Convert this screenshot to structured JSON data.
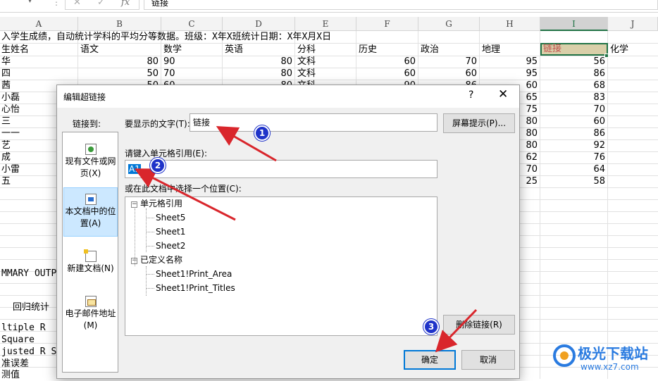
{
  "formula_bar": {
    "namebox_arrow": "▾",
    "dots": "⋮",
    "cancel": "✕",
    "enter": "✓",
    "fx": "fx",
    "content": "链接"
  },
  "columns": [
    "A",
    "B",
    "C",
    "D",
    "E",
    "F",
    "G",
    "H",
    "I",
    "J"
  ],
  "sheet": {
    "title_row": "入学生成绩，自动统计学科的平均分等数据。班级：X年X班统计日期：X年X月X日",
    "headers": [
      "生姓名",
      "语文",
      "数学",
      "英语",
      "分科",
      "历史",
      "政治",
      "地理",
      "链接",
      "化学"
    ],
    "rows": [
      [
        "华",
        "80",
        "90",
        "80",
        "文科",
        "60",
        "70",
        "95",
        "56"
      ],
      [
        "四",
        "50",
        "70",
        "80",
        "文科",
        "60",
        "60",
        "95",
        "86"
      ],
      [
        "茜",
        "50",
        "60",
        "80",
        "文科",
        "90",
        "86",
        "60",
        "68"
      ],
      [
        "小磊",
        "",
        "",
        "",
        "",
        "",
        "",
        "65",
        "83"
      ],
      [
        "心怡",
        "",
        "",
        "",
        "",
        "",
        "",
        "75",
        "70"
      ],
      [
        "三",
        "",
        "",
        "",
        "",
        "",
        "",
        "80",
        "60"
      ],
      [
        "一一",
        "",
        "",
        "",
        "",
        "",
        "",
        "80",
        "86"
      ],
      [
        "艺",
        "",
        "",
        "",
        "",
        "",
        "",
        "80",
        "92"
      ],
      [
        "成",
        "",
        "",
        "",
        "",
        "",
        "",
        "62",
        "76"
      ],
      [
        "小雷",
        "",
        "",
        "",
        "",
        "",
        "",
        "70",
        "64"
      ],
      [
        "五",
        "",
        "",
        "",
        "",
        "",
        "",
        "25",
        "58"
      ]
    ],
    "lower_cells": [
      "MMARY OUTP",
      "回归统计",
      "ltiple R",
      "Square",
      "justed R S",
      "准误差",
      "测值"
    ]
  },
  "dialog": {
    "title": "编辑超链接",
    "help": "?",
    "close": "✕",
    "link_to_label": "链接到:",
    "link_options": [
      {
        "label_line1": "现有文件或网",
        "label_line2": "页(X)"
      },
      {
        "label_line1": "本文档中的位",
        "label_line2": "置(A)"
      },
      {
        "label_line1": "新建文档(N)",
        "label_line2": ""
      },
      {
        "label_line1": "电子邮件地址",
        "label_line2": "(M)"
      }
    ],
    "display_text_label": "要显示的文字(T):",
    "display_text_value": "链接",
    "screentip_button": "屏幕提示(P)...",
    "cell_ref_label": "请键入单元格引用(E):",
    "cell_ref_value": "A1",
    "location_label": "或在此文档中选择一个位置(C):",
    "tree": {
      "group1": "单元格引用",
      "group1_items": [
        "Sheet5",
        "Sheet1",
        "Sheet2"
      ],
      "group2": "已定义名称",
      "group2_items": [
        "Sheet1!Print_Area",
        "Sheet1!Print_Titles"
      ],
      "toggle": "−"
    },
    "remove_link_button": "删除链接(R)",
    "ok_button": "确定",
    "cancel_button": "取消"
  },
  "annotations": {
    "badge1": "1",
    "badge2": "2",
    "badge3": "3",
    "arrow_color": "#d9262c",
    "badge_color": "#1f33c9"
  },
  "watermark": {
    "text": "极光下载站",
    "url": "www.xz7.com"
  },
  "colors": {
    "selection_green": "#217346",
    "link_text_red": "#c0504d",
    "dialog_blue": "#0078d7"
  }
}
